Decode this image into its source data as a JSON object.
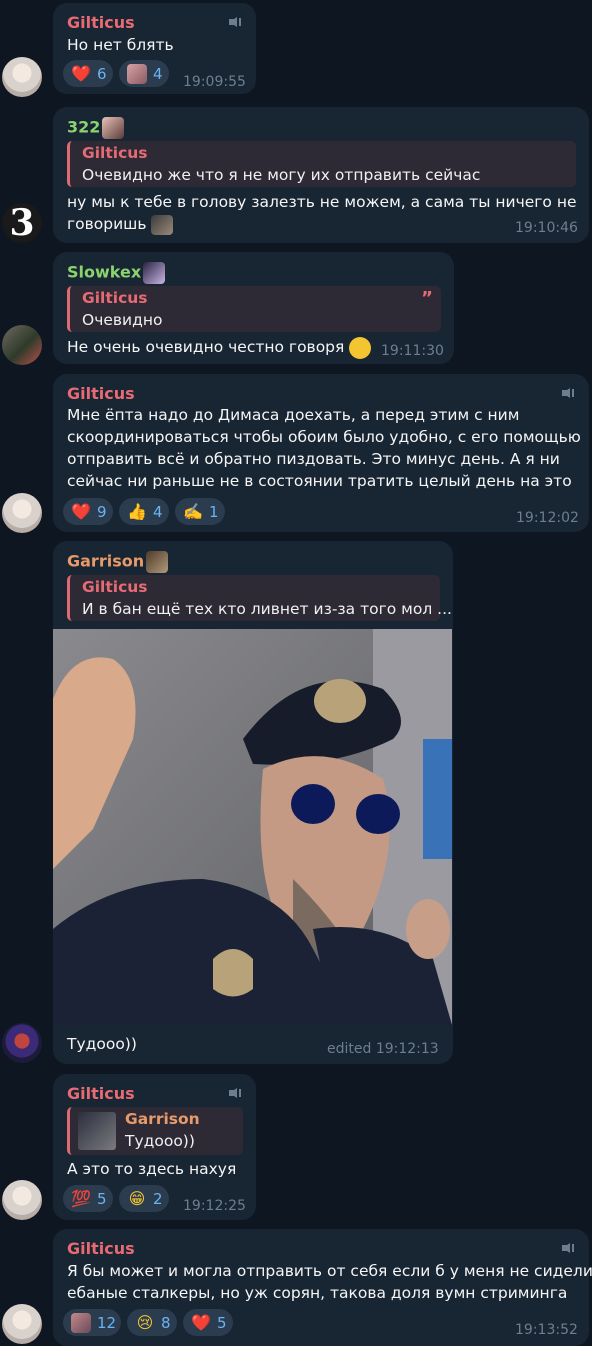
{
  "colors": {
    "bg": "#0e1621",
    "bubble": "#182533",
    "accent": "#6ab3f3",
    "gilticus": "#e86a73",
    "n322": "#8bd36e",
    "slowkex": "#8bd36e",
    "garrison": "#e89a6a"
  },
  "messages": [
    {
      "sender": "Gilticus",
      "text": "Но нет блять",
      "time": "19:09:55",
      "reactions": [
        {
          "emoji": "❤️",
          "count": "6"
        },
        {
          "emoji": "sticker",
          "count": "4"
        }
      ]
    },
    {
      "sender": "322",
      "quote": {
        "name": "Gilticus",
        "text": "Очевидно же что я не могу их отправить сейчас"
      },
      "text_l1": "ну мы к тебе в голову залезть не можем, а сама ты ничего не",
      "text_l2": "говоришь",
      "time": "19:10:46"
    },
    {
      "sender": "Slowkex",
      "quote": {
        "name": "Gilticus",
        "text": "Очевидно"
      },
      "text": "Не очень очевидно честно говоря",
      "time": "19:11:30"
    },
    {
      "sender": "Gilticus",
      "l1": "Мне ёпта надо до Димаса доехать, а перед этим с ним",
      "l2": "скоординироваться чтобы обоим было удобно, с его помощью",
      "l3": "отправить всё и обратно пиздовать. Это минус день. А я ни",
      "l4": "сейчас ни раньше не в состоянии тратить целый день на это",
      "time": "19:12:02",
      "reactions": [
        {
          "emoji": "❤️",
          "count": "9"
        },
        {
          "emoji": "👍",
          "count": "4"
        },
        {
          "emoji": "✍️",
          "count": "1"
        }
      ]
    },
    {
      "sender": "Garrison",
      "quote": {
        "name": "Gilticus",
        "text": "И в бан ещё тех кто ливнет из-за того мол ..."
      },
      "text": "Тудооо))",
      "time": "edited 19:12:13"
    },
    {
      "sender": "Gilticus",
      "quote": {
        "name": "Garrison",
        "text": "Тудооо))"
      },
      "text": "А это то здесь нахуя",
      "time": "19:12:25",
      "reactions": [
        {
          "emoji": "💯",
          "count": "5"
        },
        {
          "emoji": "😁",
          "count": "2"
        }
      ]
    },
    {
      "sender": "Gilticus",
      "l1": "Я бы может и могла отправить от себя если б у меня не сидели",
      "l2": "ебаные сталкеры, но уж сорян, такова доля вумн стриминга",
      "time": "19:13:52",
      "reactions": [
        {
          "emoji": "sticker",
          "count": "12"
        },
        {
          "emoji": "😢",
          "count": "8"
        },
        {
          "emoji": "❤️",
          "count": "5"
        }
      ]
    }
  ]
}
